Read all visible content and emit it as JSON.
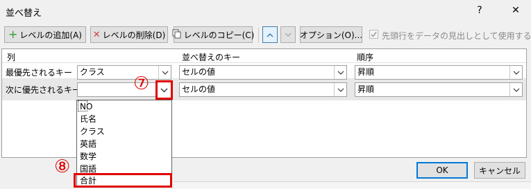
{
  "dialog": {
    "title": "並べ替え",
    "help_glyph": "?",
    "close_glyph": "✕"
  },
  "toolbar": {
    "add_level": "レベルの追加(A)",
    "delete_level": "レベルの削除(D)",
    "copy_level": "レベルのコピー(C)",
    "options": "オプション(O)...",
    "has_headers_label": "先頭行をデータの見出しとして使用する(H)",
    "has_headers_checked": true
  },
  "columns": {
    "col": "列",
    "sort_on": "並べ替えのキー",
    "order": "順序"
  },
  "rows": [
    {
      "label": "最優先されるキー",
      "column_value": "クラス",
      "sort_on": "セルの値",
      "order": "昇順"
    },
    {
      "label": "次に優先されるキー",
      "column_value": "",
      "sort_on": "セルの値",
      "order": "昇順"
    }
  ],
  "dropdown_items": [
    "NO",
    "氏名",
    "クラス",
    "英語",
    "数学",
    "国語",
    "合計"
  ],
  "annotations": {
    "step7": "⑦",
    "step8": "⑧"
  },
  "buttons": {
    "ok": "OK",
    "cancel": "キャンセル"
  },
  "colors": {
    "highlight": "#e00000",
    "accent": "#0078d7"
  }
}
